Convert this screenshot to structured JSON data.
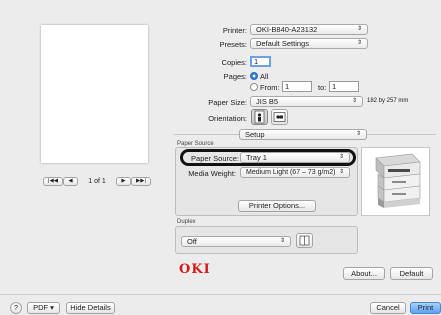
{
  "printer": {
    "label": "Printer:",
    "value": "OKI-B840-A23132"
  },
  "presets": {
    "label": "Presets:",
    "value": "Default Settings"
  },
  "copies": {
    "label": "Copies:",
    "value": "1"
  },
  "pages": {
    "label": "Pages:",
    "all": "All",
    "from_label": "From:",
    "from_value": "1",
    "to_label": "to:",
    "to_value": "1"
  },
  "paper_size": {
    "label": "Paper Size:",
    "value": "JIS B5",
    "dimensions": "182 by 257 mm"
  },
  "orientation": {
    "label": "Orientation:"
  },
  "section_menu": {
    "value": "Setup"
  },
  "paper_source_group": {
    "title": "Paper Source",
    "source_label": "Paper Source:",
    "source_value": "Tray 1",
    "weight_label": "Media Weight:",
    "weight_value": "Medium Light (67 – 73 g/m2)",
    "printer_options_button": "Printer Options..."
  },
  "duplex_group": {
    "title": "Duplex",
    "value": "Off"
  },
  "brand": {
    "logo": "OKI",
    "color": "#d21a1a"
  },
  "preview_nav": {
    "first": "|◀◀",
    "prev": "◀",
    "page_text": "1 of 1",
    "next": "▶",
    "last": "▶▶|"
  },
  "footer": {
    "help": "?",
    "pdf": "PDF ▾",
    "hide_details": "Hide Details",
    "about": "About...",
    "default": "Default",
    "cancel": "Cancel",
    "print": "Print"
  },
  "colors": {
    "accent": "#2e7bd6",
    "highlight_ring": "#111111"
  }
}
